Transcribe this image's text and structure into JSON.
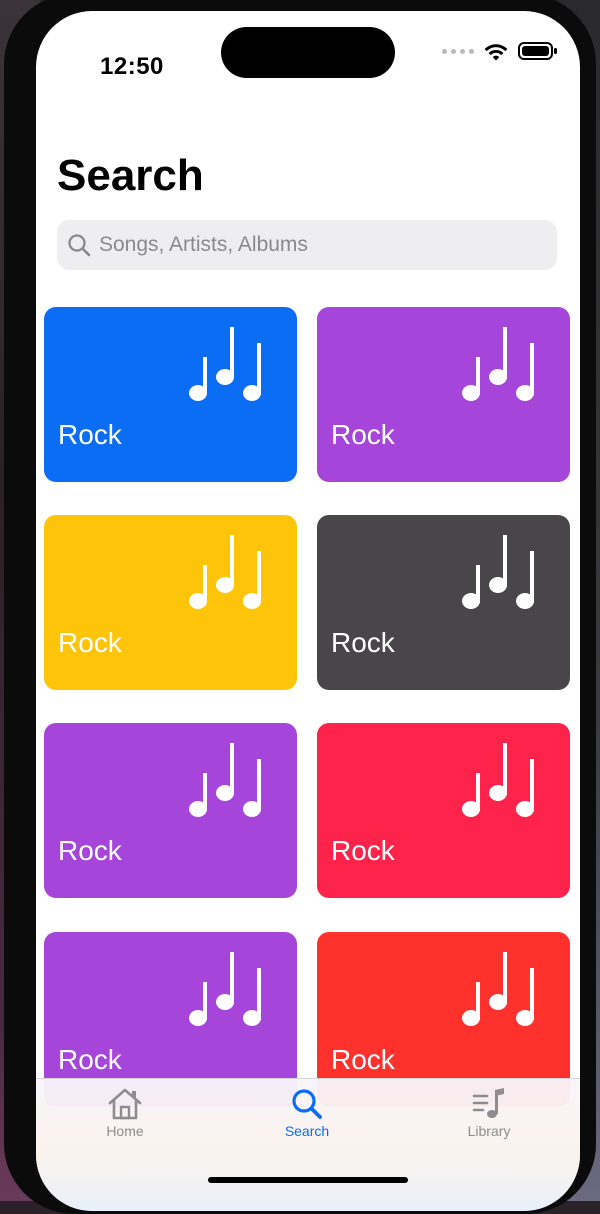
{
  "status": {
    "time": "12:50"
  },
  "page": {
    "title": "Search"
  },
  "search": {
    "placeholder": "Songs, Artists, Albums"
  },
  "cards": [
    {
      "label": "Rock",
      "color": "#0a6df3"
    },
    {
      "label": "Rock",
      "color": "#a545d9"
    },
    {
      "label": "Rock",
      "color": "#fec40a"
    },
    {
      "label": "Rock",
      "color": "#48464a"
    },
    {
      "label": "Rock",
      "color": "#a545d9"
    },
    {
      "label": "Rock",
      "color": "#fd234b"
    },
    {
      "label": "Rock",
      "color": "#a545d9"
    },
    {
      "label": "Rock",
      "color": "#fe312d"
    }
  ],
  "tabs": [
    {
      "label": "Home",
      "icon": "house-icon",
      "active": false
    },
    {
      "label": "Search",
      "icon": "search-icon",
      "active": true
    },
    {
      "label": "Library",
      "icon": "music-list-icon",
      "active": false
    }
  ],
  "colors": {
    "accent": "#0a6df3",
    "inactive": "#8e8c8f"
  }
}
